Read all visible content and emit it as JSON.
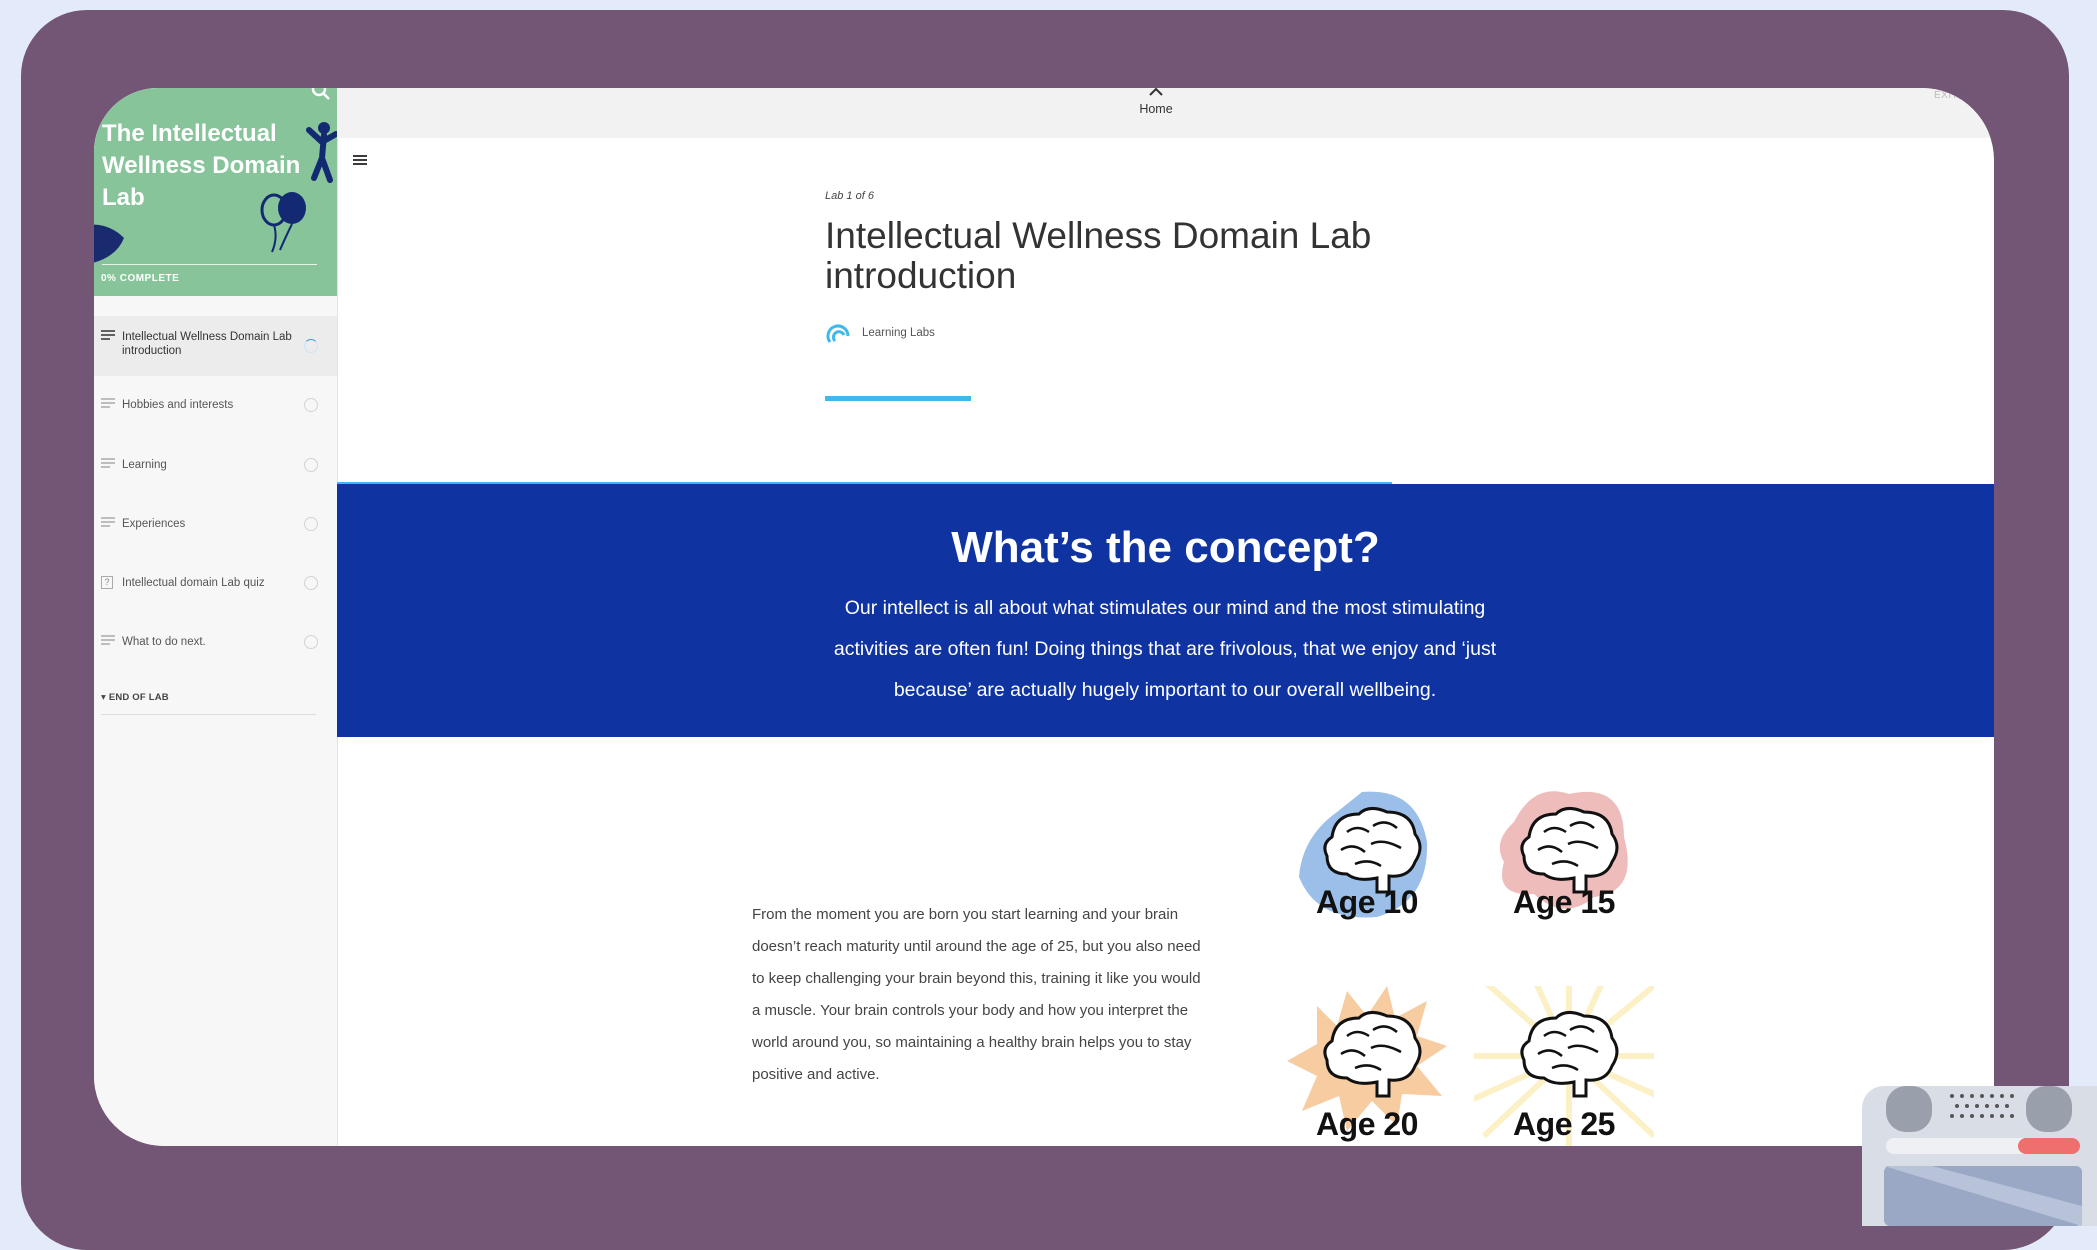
{
  "sidebar": {
    "course_title": "The Intellectual Wellness Domain Lab",
    "progress": "0% COMPLETE",
    "progress_fraction": 0,
    "lessons": [
      {
        "label": "Intellectual Wellness Domain Lab introduction",
        "icon": "text-lines-icon",
        "active": true
      },
      {
        "label": "Hobbies and interests",
        "icon": "text-lines-icon"
      },
      {
        "label": "Learning",
        "icon": "text-lines-icon"
      },
      {
        "label": "Experiences",
        "icon": "text-lines-icon"
      },
      {
        "label": "Intellectual domain Lab quiz",
        "icon": "quiz-icon"
      },
      {
        "label": "What to do next.",
        "icon": "text-lines-icon"
      }
    ],
    "end_section": "END OF LAB",
    "accent_color": "#87c49a"
  },
  "topbar": {
    "home_label": "Home",
    "exit_label": "EXIT CO"
  },
  "lesson": {
    "counter": "Lab 1 of 6",
    "title": "Intellectual Wellness Domain Lab introduction",
    "author": "Learning Labs"
  },
  "concept": {
    "heading": "What’s the concept?",
    "body": "Our intellect is all about what stimulates our mind and the most stimulating activities are often fun! Doing things that are frivolous, that we enjoy and ‘just because’ are actually hugely important to our overall wellbeing.",
    "background_color": "#0f33a0"
  },
  "content": {
    "paragraph": "From the moment you are born you start learning and your brain doesn’t reach maturity until around the age of 25, but you also need to keep challenging your brain beyond this, training it like you would a muscle. Your brain controls your body and how you interpret the world around you, so maintaining a healthy brain helps you to stay positive and active.",
    "brain_images": [
      {
        "label": "Age 10",
        "color": "#9cbfe9"
      },
      {
        "label": "Age 15",
        "color": "#efbcbc"
      },
      {
        "label": "Age 20",
        "color": "#f6ccA0"
      },
      {
        "label": "Age 25",
        "color": "#fbf0c6"
      }
    ]
  }
}
